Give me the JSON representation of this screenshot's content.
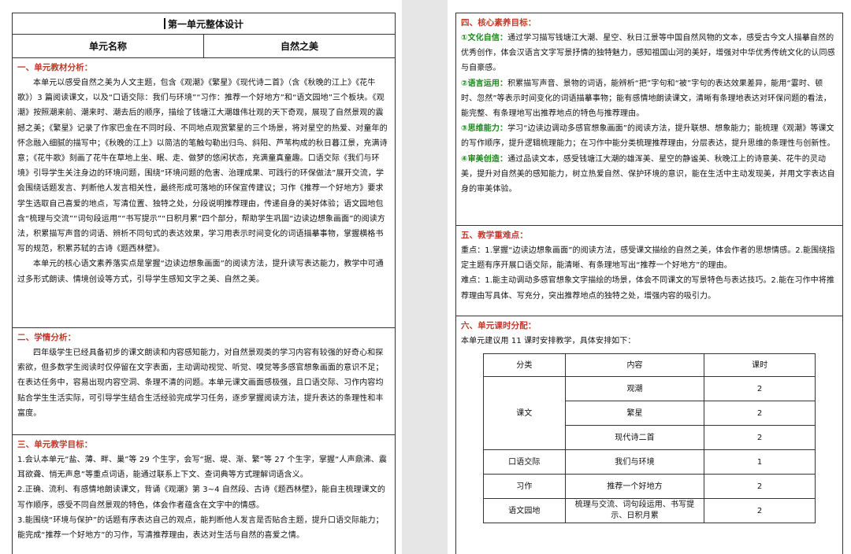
{
  "left": {
    "title": "第一单元整体设计",
    "unit_name_label": "单元名称",
    "unit_name_value": "自然之美",
    "s1": {
      "title": "一、单元教材分析：",
      "p1": "本单元以感受自然之美为人文主题，包含《观潮》《繁星》《现代诗二首》（含《秋晚的江上》《花牛歌》）3 篇阅读课文，以及“口语交际：我们与环境”“习作：推荐一个好地方”和“语文园地”三个板块。《观潮》按照潮来前、潮来时、潮去后的顺序，描绘了钱塘江大潮雄伟壮观的天下奇观，展现了自然景观的震撼之美；《繁星》记录了作家巴金在不同时段、不同地点观赏繁星的三个场景，将对星空的热爱、对童年的怀念融入细腻的描写中；《秋晚的江上》以简洁的笔触勾勒出归鸟、斜阳、芦苇构成的秋日暮江景，充满诗意；《花牛歌》刻画了花牛在草地上坐、眠、走、做梦的悠闲状态，充满童真童趣。口语交际《我们与环境》引导学生关注身边的环境问题，围绕“环境问题的危害、治理成果、可践行的环保做法”展开交流，学会围绕话题发言、判断他人发言相关性，最终形成可落地的环保宣传建议；习作《推荐一个好地方》要求学生选取自己喜爱的地点，写清位置、独特之处，分段说明推荐理由，传递自身的美好体验；语文园地包含“梳理与交流”“词句段运用”“书写提示”“日积月累”四个部分，帮助学生巩固“边读边想象画面”的阅读方法，积累描写声音的词语、辨析不同句式的表达效果，学习用表示时间变化的词语描摹事物，掌握横格书写的规范，积累苏轼的古诗《题西林壁》。",
      "p2": "本单元的核心语文素养落实点是掌握“边读边想象画面”的阅读方法，提升读写表达能力，教学中可通过多形式朗读、情境创设等方式，引导学生感知文字之美、自然之美。"
    },
    "s2": {
      "title": "二、学情分析：",
      "p1": "四年级学生已经具备初步的课文朗读和内容感知能力，对自然景观类的学习内容有较强的好奇心和探索欲，但多数学生阅读时仅停留在文字表面，主动调动视觉、听觉、嗅觉等多感官想象画面的意识不足；在表达任务中，容易出现内容空洞、条理不清的问题。本单元课文画面感极强，且口语交际、习作内容均贴合学生生活实际，可引导学生结合生活经验完成学习任务，逐步掌握阅读方法，提升表达的条理性和丰富度。"
    },
    "s3": {
      "title": "三、单元教学目标：",
      "items": [
        "1.会认本单元“盐、薄、畔、巢”等 29 个生字，会写“据、堤、渐、繁”等 27 个生字，掌握“人声鼎沸、震耳欲聋、悄无声息”等重点词语，能通过联系上下文、查词典等方式理解词语含义。",
        "2.正确、流利、有感情地朗读课文，背诵《观潮》第 3~4 自然段、古诗《题西林壁》，能自主梳理课文的写作顺序，感受不同自然景观的特色，体会作者蕴含在文字中的情感。",
        "3.能围绕“环境与保护”的话题有序表达自己的观点，能判断他人发言是否贴合主题，提升口语交际能力；能完成“推荐一个好地方”的习作，写清推荐理由，表达对生活与自然的喜爱之情。"
      ]
    }
  },
  "right": {
    "s4": {
      "title": "四、核心素养目标：",
      "items": [
        {
          "tag": "①文化自信：",
          "text": "通过学习描写钱塘江大潮、星空、秋日江景等中国自然风物的文本，感受古今文人描摹自然的优秀创作，体会汉语言文字写景抒情的独特魅力，感知祖国山河的美好，增强对中华优秀传统文化的认同感与自豪感。"
        },
        {
          "tag": "②语言运用：",
          "text": "积累描写声音、景物的词语，能辨析“把”字句和“被”字句的表达效果差异，能用“霎时、顿时、忽然”等表示时间变化的词语描摹事物；能有感情地朗读课文，清晰有条理地表达对环保问题的看法，能完整、有条理地写出推荐地点的特色与推荐理由。"
        },
        {
          "tag": "③思维能力：",
          "text": "学习“边读边调动多感官想象画面”的阅读方法，提升联想、想象能力；能梳理《观潮》等课文的写作顺序，提升逻辑梳理能力；在习作中能分类梳理推荐理由，分层表达，提升思维的条理性与创新性。"
        },
        {
          "tag": "④审美创造：",
          "text": "通过品读文本，感受钱塘江大潮的雄浑美、星空的静谧美、秋晚江上的诗意美、花牛的灵动美，提升对自然美的感知能力，树立热爱自然、保护环境的意识，能在生活中主动发现美，并用文字表达自身的审美体验。"
        }
      ]
    },
    "s5": {
      "title": "五、教学重难点：",
      "p1": "重点：1.掌握“边读边想象画面”的阅读方法，感受课文描绘的自然之美，体会作者的思想情感。2.能围绕指定主题有序开展口语交际，能清晰、有条理地写出“推荐一个好地方”的理由。",
      "p2": "难点：1.能主动调动多感官想象文字描绘的场景，体会不同课文的写景特色与表达技巧。2.能在习作中将推荐理由写具体、写充分，突出推荐地点的独特之处，增强内容的吸引力。"
    },
    "s6": {
      "title": "六、单元课时分配：",
      "intro": "本单元建议用 11 课时安排教学，具体安排如下：",
      "headers": [
        "分类",
        "内容",
        "课时"
      ],
      "groups": [
        {
          "category": "课文",
          "rows": [
            [
              "观潮",
              "2"
            ],
            [
              "繁星",
              "2"
            ],
            [
              "现代诗二首",
              "2"
            ]
          ]
        },
        {
          "category": "口语交际",
          "rows": [
            [
              "我们与环境",
              "1"
            ]
          ]
        },
        {
          "category": "习作",
          "rows": [
            [
              "推荐一个好地方",
              "2"
            ]
          ]
        },
        {
          "category": "语文园地",
          "rows": [
            [
              "梳理与交流、词句段运用、书写提示、日积月累",
              "2"
            ]
          ]
        }
      ]
    }
  }
}
